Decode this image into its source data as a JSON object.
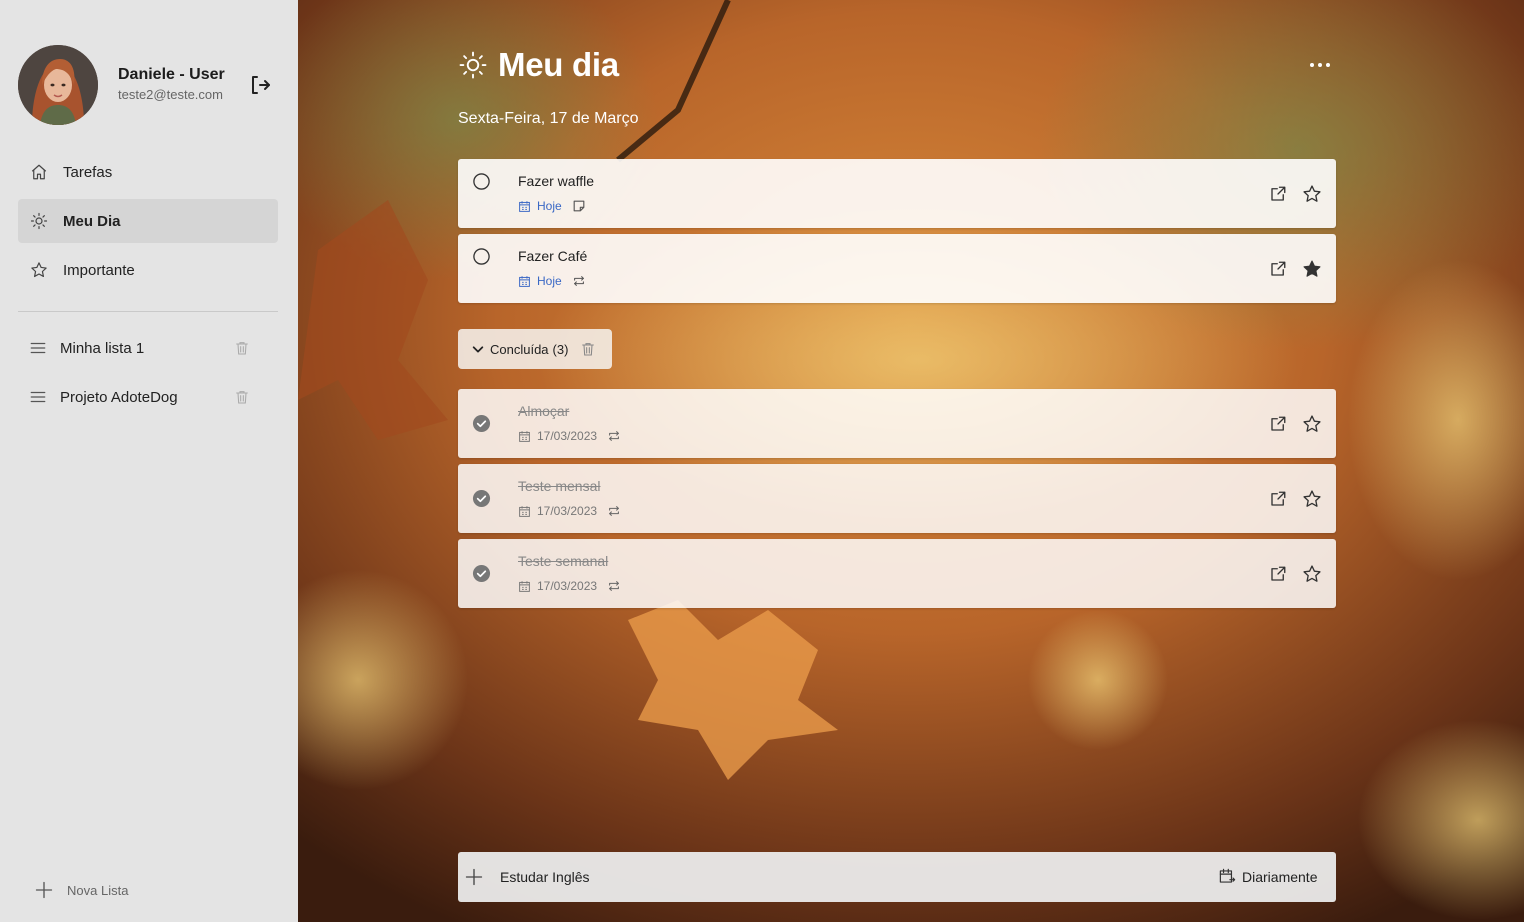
{
  "colors": {
    "sidebar_bg": "#e4e4e4",
    "active_item_bg": "#d5d5d5",
    "link_blue": "#3a68c5",
    "card_bg": "#ffffff"
  },
  "user": {
    "name": "Daniele - User",
    "email": "teste2@teste.com"
  },
  "nav": [
    {
      "label": "Tarefas",
      "icon": "home-icon"
    },
    {
      "label": "Meu Dia",
      "icon": "sun-icon"
    },
    {
      "label": "Importante",
      "icon": "star-icon"
    }
  ],
  "lists": [
    {
      "label": "Minha lista 1",
      "icon": "list-icon"
    },
    {
      "label": "Projeto AdoteDog",
      "icon": "list-icon"
    }
  ],
  "new_list_label": "Nova Lista",
  "header": {
    "title": "Meu dia",
    "date": "Sexta-Feira, 17 de Março"
  },
  "tasks": [
    {
      "title": "Fazer waffle",
      "due": "Hoje",
      "extra_icon": "note-icon",
      "starred": false,
      "done": false
    },
    {
      "title": "Fazer Café",
      "due": "Hoje",
      "extra_icon": "repeat-icon",
      "starred": true,
      "done": false
    }
  ],
  "completed": {
    "label": "Concluída",
    "count": "(3)",
    "items": [
      {
        "title": "Almoçar",
        "due": "17/03/2023",
        "extra_icon": "repeat-icon",
        "starred": false,
        "done": true
      },
      {
        "title": "Teste mensal",
        "due": "17/03/2023",
        "extra_icon": "repeat-icon",
        "starred": false,
        "done": true
      },
      {
        "title": "Teste semanal",
        "due": "17/03/2023",
        "extra_icon": "repeat-icon",
        "starred": false,
        "done": true
      }
    ]
  },
  "add_task": {
    "value": "Estudar Inglês",
    "repeat_label": "Diariamente"
  }
}
